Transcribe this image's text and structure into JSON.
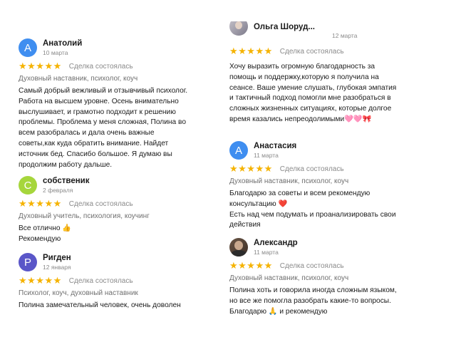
{
  "left": [
    {
      "initial": "А",
      "avatar_color": "#3f8ef0",
      "name": "Анатолий",
      "date": "10 марта",
      "stars": "★★★★★",
      "deal": "Сделка состоялась",
      "tags": "Духовный наставник, психолог, коуч",
      "text": [
        "Самый добрый вежливый и отзывчивый психолог.",
        "Работа на высшем уровне. Осень внимательно",
        "выслушивает, и грамотно подходит к решению",
        "проблемы. Проблема у меня сложная, Полина во",
        "всем разобралась и дала очень важные",
        "советы,как куда обратить внимание. Найдет",
        "источник бед. Спасибо большое. Я думаю вы",
        "продолжим работу дальше."
      ]
    },
    {
      "initial": "С",
      "avatar_color": "#a6d63c",
      "name": "собственик",
      "date": "2 февраля",
      "stars": "★★★★★",
      "deal": "Сделка состоялась",
      "tags": "Духовный учитель, психология, коучинг",
      "text": [
        "Все отлично 👍",
        "Рекомендую"
      ]
    },
    {
      "initial": "Р",
      "avatar_color": "#5a56c8",
      "name": "Ригден",
      "date": "12 января",
      "stars": "★★★★★",
      "deal": "Сделка состоялась",
      "tags": "Психолог, коуч, духовный наставник",
      "text": [
        "Полина замечательный человек, очень доволен"
      ]
    }
  ],
  "right": [
    {
      "photo": true,
      "name": "Ольга Шоруд...",
      "date": "12 марта",
      "stars": "★★★★★",
      "deal": "Сделка состоялась",
      "text": [
        "Хочу выразить огромную благодарность за",
        "помощь и поддержку,которую я получила на",
        "сеансе. Ваше умение слушать, глубокая эмпатия",
        "и тактичный подход помогли мне разобраться в",
        "сложных жизненных ситуациях, которые долгое",
        "время казались непреодолимыми🩷🩷🎀"
      ]
    },
    {
      "initial": "А",
      "avatar_color": "#3f8ef0",
      "name": "Анастасия",
      "date": "11 марта",
      "stars": "★★★★★",
      "deal": "Сделка состоялась",
      "tags": "Духовный наставник, психолог, коуч",
      "text": [
        "Благодарю за советы и всем рекомендую",
        "консультацию ❤️",
        "Есть над чем подумать и проанализировать свои",
        "действия"
      ]
    },
    {
      "photo": true,
      "name": "Александр",
      "date": "11 марта",
      "stars": "★★★★★",
      "deal": "Сделка состоялась",
      "tags": "Духовный наставник, психолог, коуч",
      "text": [
        "Полина хоть и говорила иногда сложным языком,",
        "но все же помогла разобрать какие-то вопросы.",
        "Благодарю 🙏 и рекомендую"
      ]
    }
  ]
}
